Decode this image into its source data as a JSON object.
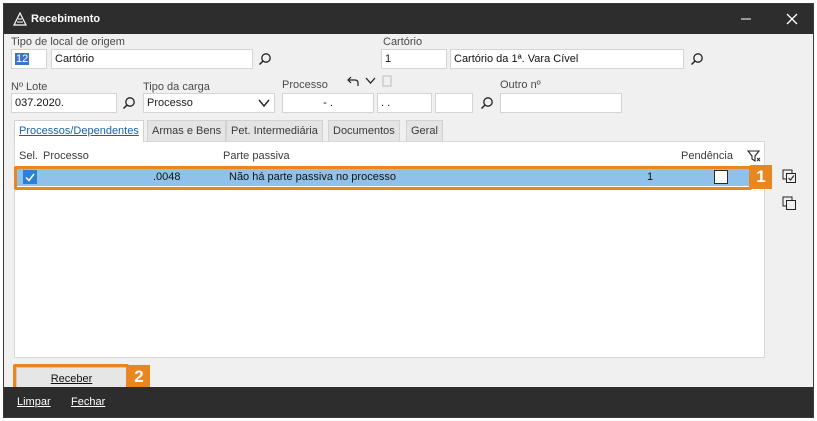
{
  "window": {
    "title": "Recebimento"
  },
  "form": {
    "tipo_local": {
      "label": "Tipo de local de origem",
      "code": "12",
      "name": "Cartório"
    },
    "cartorio": {
      "label": "Cartório",
      "code": "1",
      "name": "Cartório da 1ª. Vara Cível"
    },
    "lote": {
      "label": "Nº Lote",
      "value": "037.2020."
    },
    "tipo_carga": {
      "label": "Tipo da carga",
      "value": "Processo"
    },
    "processo": {
      "label": "Processo",
      "part1": " - .",
      "part2": ". .",
      "part3": ""
    },
    "outro": {
      "label": "Outro nº",
      "value": ""
    }
  },
  "tabs": [
    {
      "label": "Processos/Dependentes",
      "active": true
    },
    {
      "label": "Armas e Bens",
      "active": false
    },
    {
      "label": "Pet. Intermediária",
      "active": false
    },
    {
      "label": "Documentos",
      "active": false
    },
    {
      "label": "Geral",
      "active": false
    }
  ],
  "grid": {
    "headers": {
      "sel": "Sel.",
      "processo": "Processo",
      "parte": "Parte passiva",
      "pendencia": "Pendência"
    },
    "rows": [
      {
        "processo": ".0048",
        "parte": "Não há parte passiva no processo",
        "count": "1",
        "selected": true,
        "pendencia": false
      }
    ]
  },
  "badges": {
    "one": "1",
    "two": "2"
  },
  "buttons": {
    "receber": "Receber"
  },
  "bottom": {
    "limpar": "Limpar",
    "fechar": "Fechar"
  },
  "colors": {
    "accent": "#e8871f",
    "row_selected": "#8fc1ea",
    "titlebar": "#2d2d2d"
  }
}
